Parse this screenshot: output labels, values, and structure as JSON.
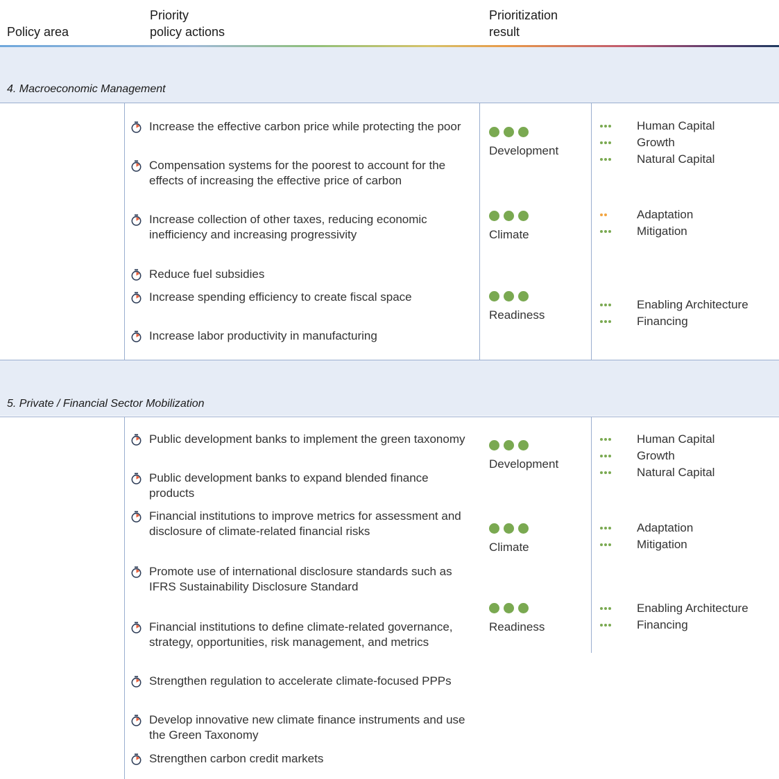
{
  "header": {
    "col1": "Policy area",
    "col2_line1": "Priority",
    "col2_line2": "policy actions",
    "col3_line1": "Prioritization",
    "col3_line2": "result"
  },
  "sections": [
    {
      "title": "4. Macroeconomic Management",
      "actions": [
        "Increase the effective carbon price while protecting the poor",
        "Compensation systems for the poorest to account for the effects of increasing the effective price of carbon",
        "Increase collection of other taxes, reducing economic inefficiency and increasing progressivity",
        "Reduce fuel subsidies",
        "Increase spending efficiency to create fiscal space",
        "Increase labor productivity in manufacturing"
      ],
      "results": [
        {
          "label": "Development",
          "dots": 3,
          "subs": [
            {
              "name": "Human Capital",
              "dots": 3
            },
            {
              "name": "Growth",
              "dots": 3
            },
            {
              "name": "Natural Capital",
              "dots": 3
            }
          ]
        },
        {
          "label": "Climate",
          "dots": 3,
          "subs": [
            {
              "name": "Adaptation",
              "dots": 2,
              "color": "#f2a541"
            },
            {
              "name": "Mitigation",
              "dots": 3
            }
          ]
        },
        {
          "label": "Readiness",
          "dots": 3,
          "subs": [
            {
              "name": "Enabling Architecture",
              "dots": 3
            },
            {
              "name": "Financing",
              "dots": 3
            }
          ]
        }
      ]
    },
    {
      "title": "5. Private / Financial Sector Mobilization",
      "actions": [
        "Public development banks to implement the green taxonomy",
        "Public development banks to expand blended finance products",
        "Financial institutions to improve metrics for assessment and disclosure of climate-related financial risks",
        "Promote use of international disclosure standards such as IFRS Sustainability Disclosure Standard",
        "Financial institutions to define climate-related governance, strategy, opportunities, risk management, and metrics",
        "Strengthen regulation to accelerate climate-focused PPPs",
        "Develop innovative new climate finance instruments and use the Green Taxonomy",
        "Strengthen carbon credit markets"
      ],
      "results": [
        {
          "label": "Development",
          "dots": 3,
          "subs": [
            {
              "name": "Human Capital",
              "dots": 3
            },
            {
              "name": "Growth",
              "dots": 3
            },
            {
              "name": "Natural Capital",
              "dots": 3
            }
          ]
        },
        {
          "label": "Climate",
          "dots": 3,
          "subs": [
            {
              "name": "Adaptation",
              "dots": 3
            },
            {
              "name": "Mitigation",
              "dots": 3
            }
          ]
        },
        {
          "label": "Readiness",
          "dots": 3,
          "subs": [
            {
              "name": "Enabling Architecture",
              "dots": 3
            },
            {
              "name": "Financing",
              "dots": 3
            }
          ]
        }
      ]
    }
  ],
  "colors": {
    "green": "#7aa951",
    "orange": "#f2a541",
    "band": "#e6ecf6",
    "icon_accent": "#e8603c",
    "icon_ring": "#2b3a55"
  },
  "icon": "stopwatch-icon"
}
